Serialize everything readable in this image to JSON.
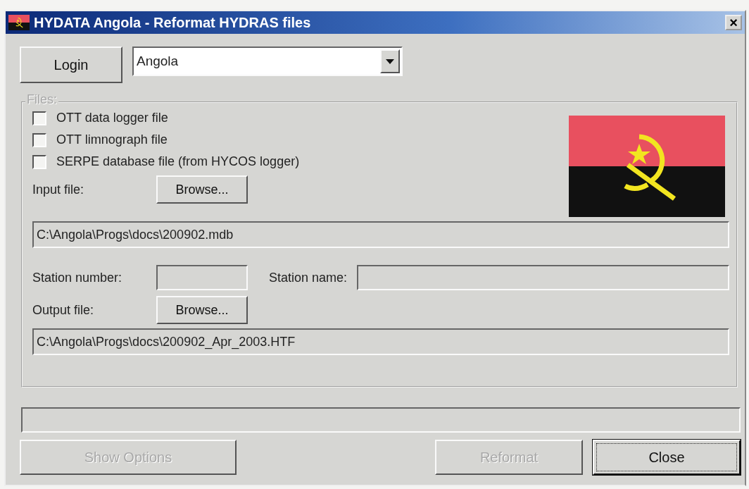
{
  "window": {
    "title": "HYDATA Angola - Reformat HYDRAS files",
    "close_label": "×"
  },
  "login_button": {
    "label": "Login"
  },
  "country_select": {
    "value": "Angola"
  },
  "files_group": {
    "legend": "Files:",
    "disabled": true,
    "checkboxes": [
      {
        "label": "OTT data logger file",
        "checked": false
      },
      {
        "label": "OTT limnograph file",
        "checked": false
      },
      {
        "label": "SERPE database file (from HYCOS logger)",
        "checked": false
      }
    ],
    "input_file": {
      "label": "Input file:",
      "browse": "Browse...",
      "path": "C:\\Angola\\Progs\\docs\\200902.mdb"
    },
    "station_number": {
      "label": "Station number:"
    },
    "station_name": {
      "label": "Station name:"
    },
    "output_file": {
      "label": "Output file:",
      "browse": "Browse...",
      "path": "C:\\Angola\\Progs\\docs\\200902_Apr_2003.HTF"
    }
  },
  "buttons": [
    {
      "label": "Show Options",
      "disabled": true,
      "focused": false
    },
    {
      "label": "Reformat",
      "disabled": true,
      "focused": false
    },
    {
      "label": "Close",
      "disabled": false,
      "focused": true
    }
  ]
}
